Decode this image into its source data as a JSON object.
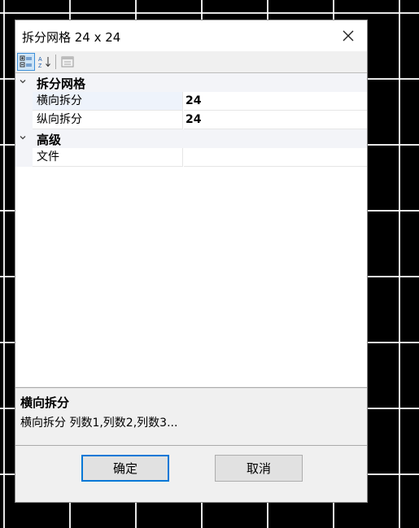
{
  "window": {
    "title": "拆分网格 24 x 24",
    "close_label": "×"
  },
  "toolbar": {
    "buttons": [
      "categorized-view",
      "alphabetical-sort",
      "property-pages"
    ]
  },
  "grid": {
    "categories": [
      {
        "label": "拆分网格",
        "expanded": true,
        "properties": [
          {
            "name": "横向拆分",
            "value": "24"
          },
          {
            "name": "纵向拆分",
            "value": "24"
          }
        ]
      },
      {
        "label": "高级",
        "expanded": true,
        "properties": [
          {
            "name": "文件",
            "value": ""
          }
        ]
      }
    ]
  },
  "description": {
    "title": "横向拆分",
    "text": "横向拆分 列数1,列数2,列数3..."
  },
  "buttons": {
    "ok": "确定",
    "cancel": "取消"
  },
  "colors": {
    "accent": "#0078d7",
    "background": "#000000"
  }
}
